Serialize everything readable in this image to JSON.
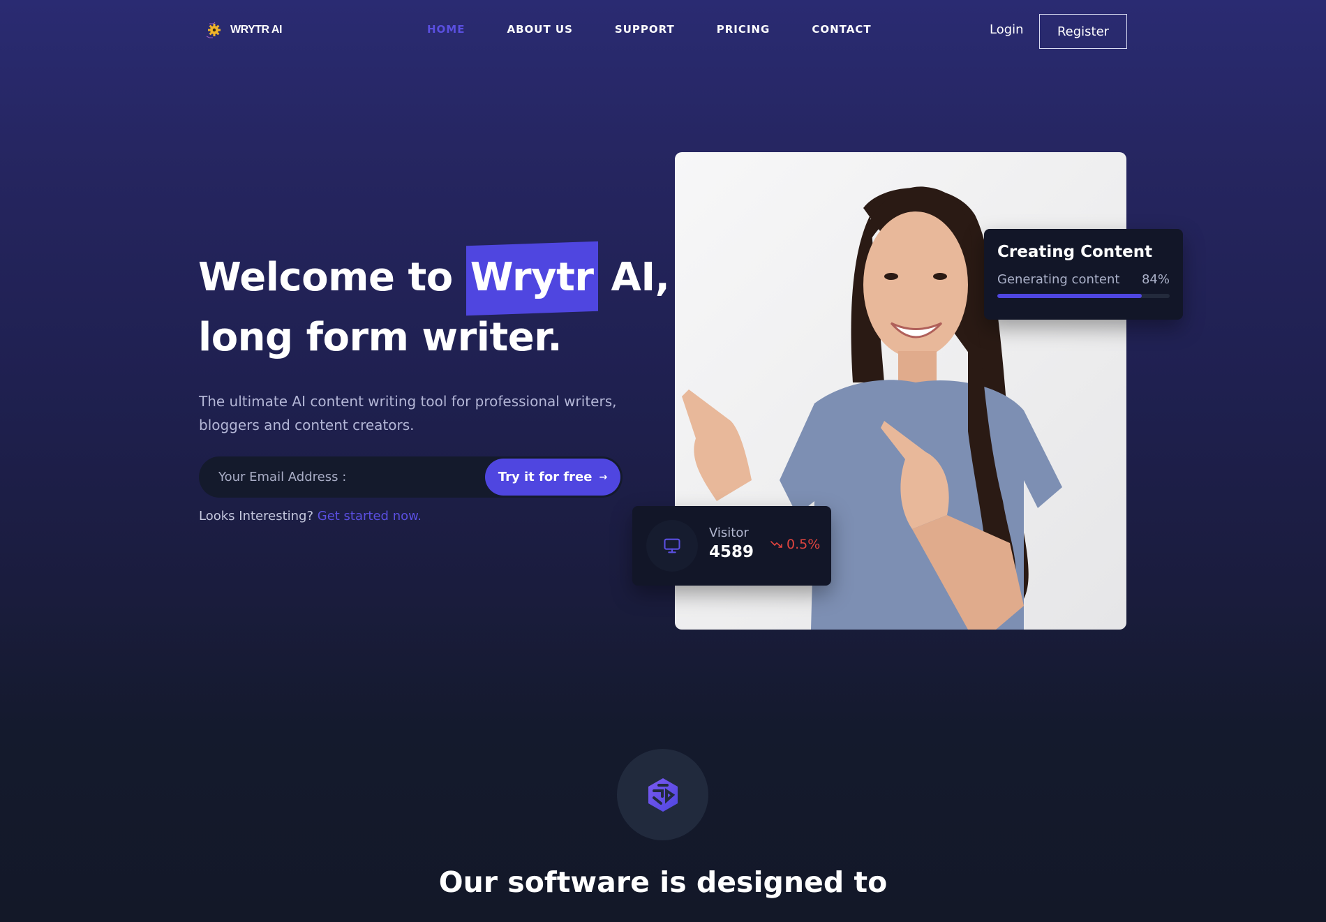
{
  "brand": {
    "name": "WRYTR AI",
    "logo_icon": "gear-icon"
  },
  "nav": {
    "items": [
      {
        "label": "HOME",
        "active": true
      },
      {
        "label": "ABOUT US",
        "active": false
      },
      {
        "label": "SUPPORT",
        "active": false
      },
      {
        "label": "PRICING",
        "active": false
      },
      {
        "label": "CONTACT",
        "active": false
      }
    ],
    "login_label": "Login",
    "register_label": "Register"
  },
  "hero": {
    "title_before": "Welcome to ",
    "title_highlight": "Wrytr",
    "title_after": " AI,",
    "title_line2": "long form writer.",
    "subtitle": "The ultimate AI content writing tool for professional writers, bloggers and content creators.",
    "email_placeholder": "Your Email Address :",
    "email_value": "",
    "cta_label": "Try it for free",
    "cta_icon": "arrow-right-icon",
    "looks_text": "Looks Interesting?",
    "looks_link": "Get started now."
  },
  "content_card": {
    "title": "Creating Content",
    "status": "Generating content",
    "percent_label": "84%",
    "progress": 0.84
  },
  "visitor_card": {
    "icon": "monitor-icon",
    "label": "Visitor",
    "value": "4589",
    "change": "0.5%",
    "trend_icon": "trending-down-icon",
    "trend_color": "#e0453f"
  },
  "colors": {
    "accent": "#4f46e0",
    "card_bg": "#121628",
    "bg_top": "#2a2b72",
    "bg_bottom": "#131828"
  },
  "features": {
    "badge_icon": "hexagon-cube-icon",
    "section_title": "Our software is designed to"
  }
}
